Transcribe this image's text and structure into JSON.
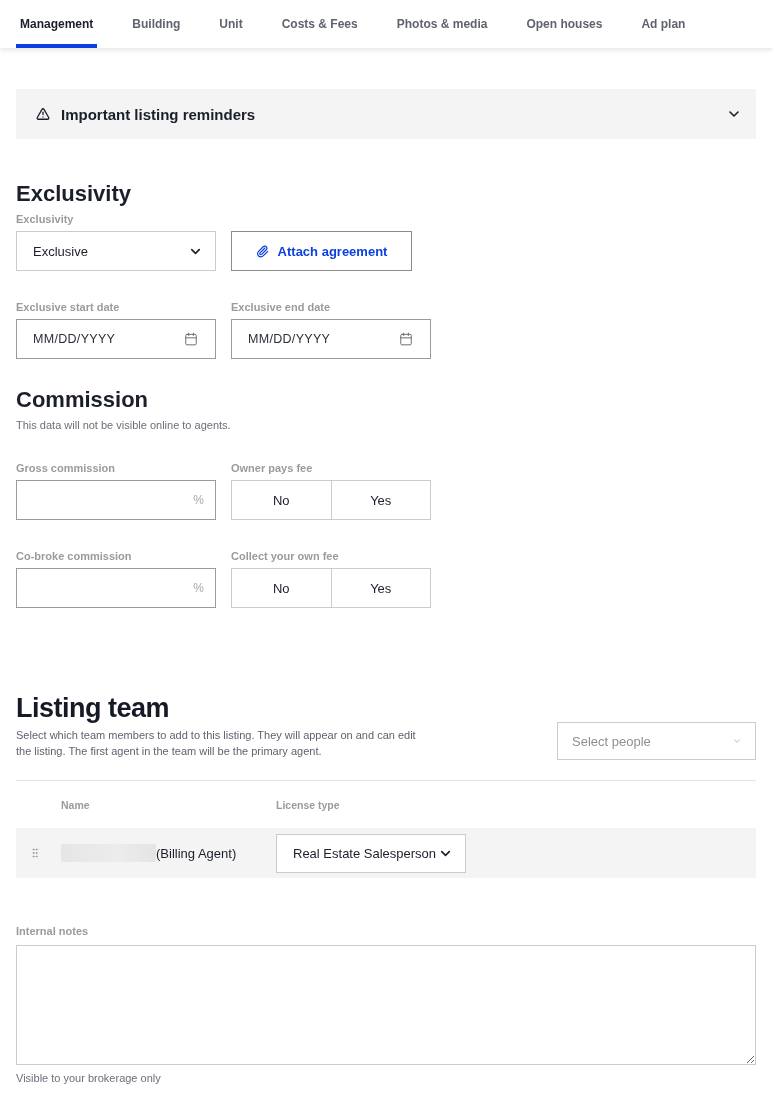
{
  "tabs": [
    {
      "label": "Management",
      "selected": true
    },
    {
      "label": "Building",
      "selected": false
    },
    {
      "label": "Unit",
      "selected": false
    },
    {
      "label": "Costs & Fees",
      "selected": false
    },
    {
      "label": "Photos & media",
      "selected": false
    },
    {
      "label": "Open houses",
      "selected": false
    },
    {
      "label": "Ad plan",
      "selected": false
    }
  ],
  "reminders": {
    "title": "Important listing reminders",
    "expanded": false
  },
  "exclusivity": {
    "heading": "Exclusivity",
    "type_select": {
      "label": "Exclusivity",
      "value": "Exclusive"
    },
    "attach_button": "Attach agreement",
    "dates": [
      {
        "label": "Exclusive start date",
        "placeholder": "MM/DD/YYYY"
      },
      {
        "label": "Exclusive end date",
        "placeholder": "MM/DD/YYYY"
      }
    ]
  },
  "commission": {
    "heading": "Commission",
    "note": "This data will not be visible online to agents.",
    "rows": [
      {
        "field": {
          "label": "Gross commission",
          "unit": "%"
        },
        "toggle": {
          "label": "Owner pays fee",
          "options": [
            {
              "label": "No",
              "selected": false
            },
            {
              "label": "Yes",
              "selected": false
            }
          ]
        }
      },
      {
        "field": {
          "label": "Co-broke commission",
          "unit": "%"
        },
        "toggle": {
          "label": "Collect your own fee",
          "options": [
            {
              "label": "No",
              "selected": false
            },
            {
              "label": "Yes",
              "selected": false
            }
          ]
        }
      }
    ]
  },
  "listing_team": {
    "heading": "Listing team",
    "description": "Select which team members to add to this listing. They will appear on and can edit the listing. The first agent in the team will be the primary agent.",
    "people_select": {
      "placeholder": "Select people"
    },
    "columns": [
      "Name",
      "License type"
    ],
    "rows": [
      {
        "name_redacted": true,
        "role": "(Billing Agent)",
        "license_type": "Real Estate Salesperson"
      }
    ]
  },
  "internal_notes": {
    "label": "Internal notes",
    "helper": "Visible to your brokerage only"
  }
}
